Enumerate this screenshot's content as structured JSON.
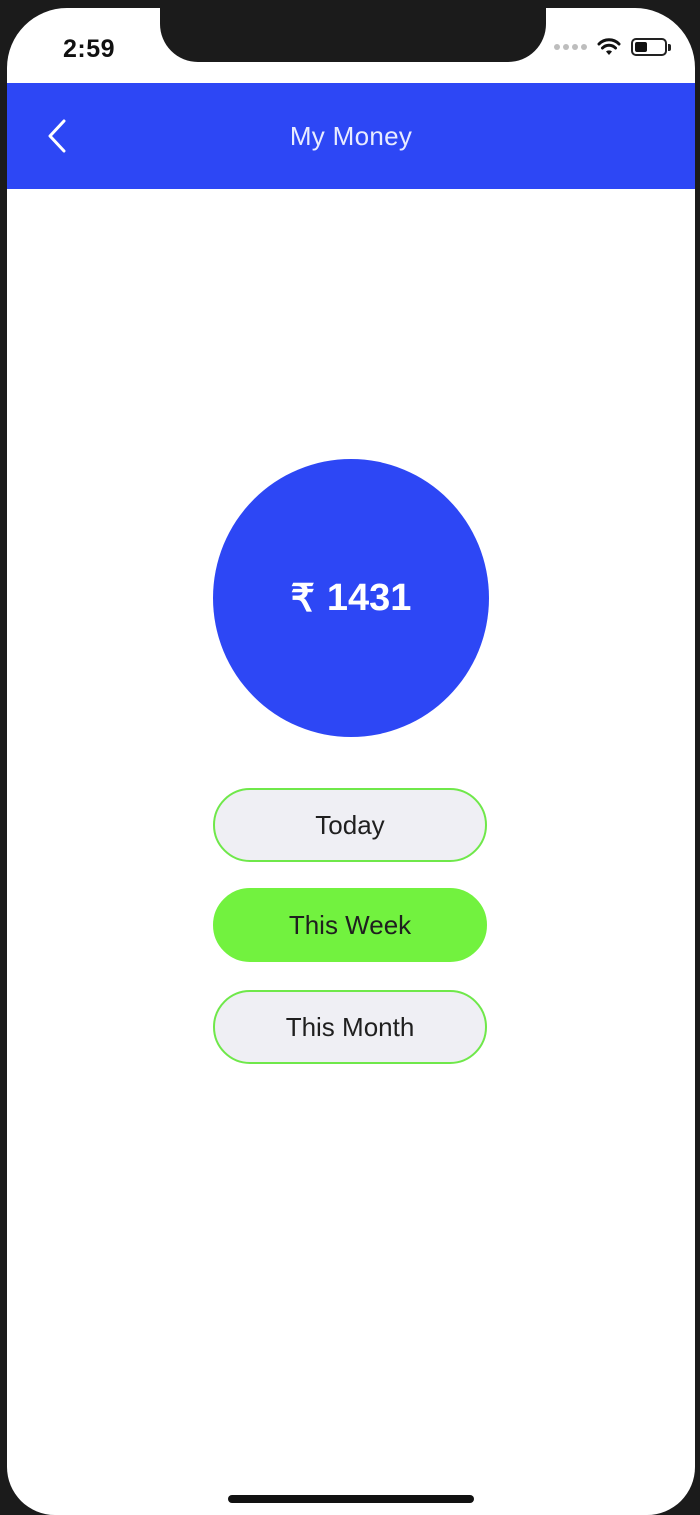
{
  "status_bar": {
    "time": "2:59",
    "icons": [
      "signal-dots-icon",
      "wifi-icon",
      "battery-icon"
    ]
  },
  "header": {
    "back_icon": "chevron-left-icon",
    "title": "My Money"
  },
  "balance": {
    "currency_symbol": "₹",
    "amount": "1431"
  },
  "period_options": [
    {
      "label": "Today",
      "selected": false
    },
    {
      "label": "This Week",
      "selected": true
    },
    {
      "label": "This Month",
      "selected": false
    }
  ],
  "colors": {
    "primary": "#2d47f5",
    "selected": "#72f23f",
    "unselected_bg": "#efeff4",
    "unselected_border": "#6fe84a"
  }
}
